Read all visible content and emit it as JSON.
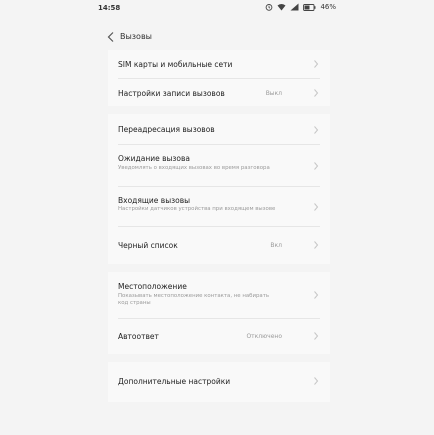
{
  "status": {
    "time": "14:58",
    "battery": "46%"
  },
  "header": {
    "back_icon": "chevron-left-icon",
    "title": "Вызовы"
  },
  "items": [
    {
      "title": "SIM карты и мобильные сети",
      "subtitle": "",
      "value": ""
    },
    {
      "title": "Настройки записи вызовов",
      "subtitle": "",
      "value": "Выкл"
    },
    {
      "title": "Переадресация вызовов",
      "subtitle": "",
      "value": ""
    },
    {
      "title": "Ожидание вызова",
      "subtitle": "Уведомлять о входящих вызовах во время разговора",
      "value": ""
    },
    {
      "title": "Входящие вызовы",
      "subtitle": "Настройки датчиков устройства при входящем вызове",
      "value": ""
    },
    {
      "title": "Черный список",
      "subtitle": "",
      "value": "Вкл"
    },
    {
      "title": "Местоположение",
      "subtitle": "Показывать местоположение контакта, не набирать код страны",
      "value": ""
    },
    {
      "title": "Автоответ",
      "subtitle": "",
      "value": "Отключено"
    },
    {
      "title": "Дополнительные настройки",
      "subtitle": "",
      "value": ""
    }
  ]
}
